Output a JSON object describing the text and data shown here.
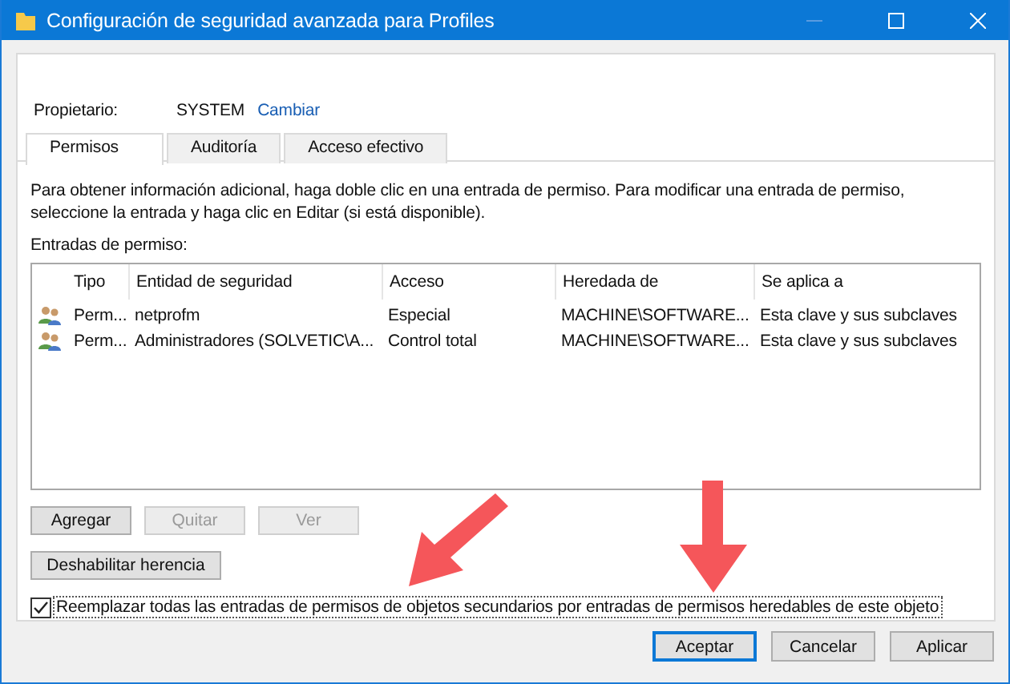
{
  "window": {
    "title": "Configuración de seguridad avanzada para Profiles"
  },
  "owner": {
    "label": "Propietario:",
    "value": "SYSTEM",
    "link": "Cambiar"
  },
  "tabs": [
    {
      "label": "Permisos",
      "selected": true
    },
    {
      "label": "Auditoría",
      "selected": false
    },
    {
      "label": "Acceso efectivo",
      "selected": false
    }
  ],
  "info": "Para obtener información adicional, haga doble clic en una entrada de permiso. Para modificar una entrada de permiso, seleccione la entrada y haga clic en Editar (si está disponible).",
  "entries_label": "Entradas de permiso:",
  "table": {
    "columns": [
      "Tipo",
      "Entidad de seguridad",
      "Acceso",
      "Heredada de",
      "Se aplica a"
    ],
    "rows": [
      [
        "Perm...",
        "netprofm",
        "Especial",
        "MACHINE\\SOFTWARE...",
        "Esta clave y sus subclaves"
      ],
      [
        "Perm...",
        "Administradores (SOLVETIC\\A...",
        "Control total",
        "MACHINE\\SOFTWARE...",
        "Esta clave y sus subclaves"
      ]
    ]
  },
  "entry_buttons": [
    {
      "label": "Agregar",
      "disabled": false
    },
    {
      "label": "Quitar",
      "disabled": true
    },
    {
      "label": "Ver",
      "disabled": true
    }
  ],
  "inheritance_button": "Deshabilitar herencia",
  "replace_checkbox": {
    "label": "Reemplazar todas las entradas de permisos de objetos secundarios por entradas de permisos heredables de este objeto",
    "checked": true
  },
  "dialog_buttons": [
    {
      "label": "Aceptar",
      "default": true
    },
    {
      "label": "Cancelar",
      "default": false
    },
    {
      "label": "Aplicar",
      "default": false
    }
  ]
}
